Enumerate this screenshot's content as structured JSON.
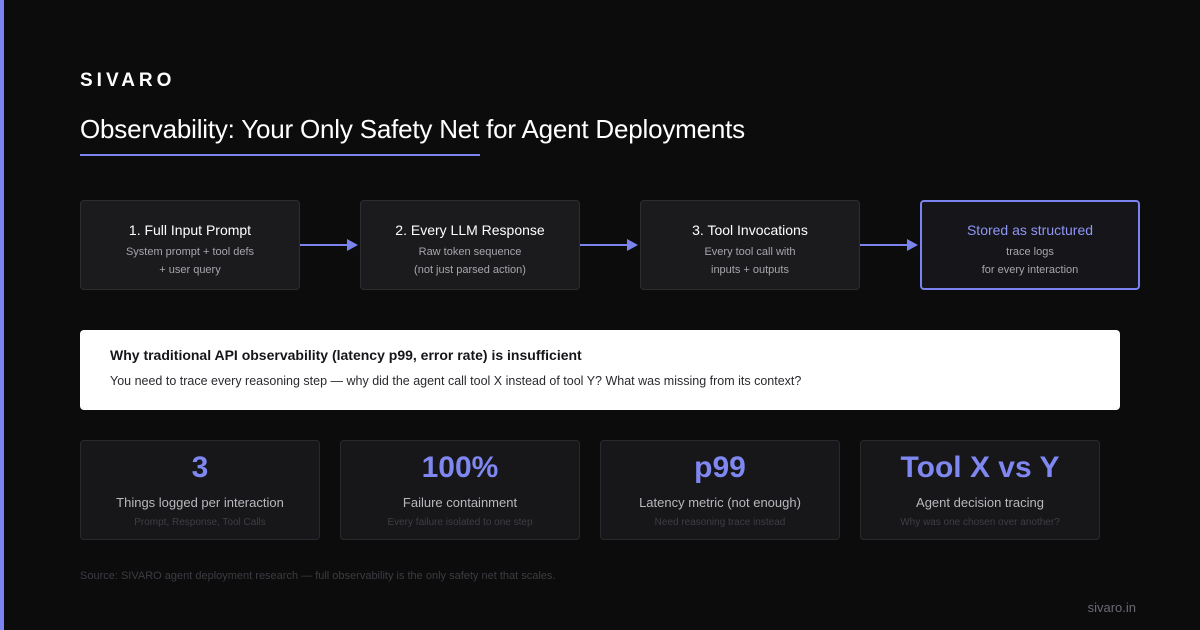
{
  "brand": "SIVARO",
  "title": "Observability: Your Only Safety Net for Agent Deployments",
  "colors": {
    "accent": "#7b83ee",
    "background": "#0c0c0d",
    "card": "#1b1b1e"
  },
  "flow": {
    "steps": [
      {
        "title": "1. Full Input Prompt",
        "line1": "System prompt + tool defs",
        "line2": "+ user query"
      },
      {
        "title": "2. Every LLM Response",
        "line1": "Raw token sequence",
        "line2": "(not just parsed action)"
      },
      {
        "title": "3. Tool Invocations",
        "line1": "Every tool call with",
        "line2": "inputs + outputs"
      },
      {
        "title": "Stored as structured",
        "line1": "trace logs",
        "line2": "for every interaction"
      }
    ],
    "arrow_icon": "arrow-right-icon"
  },
  "callout": {
    "heading": "Why traditional API observability (latency p99, error rate) is insufficient",
    "body": "You need to trace every reasoning step — why did the agent call tool X instead of tool Y? What was missing from its context?"
  },
  "stats": [
    {
      "value": "3",
      "label": "Things logged per interaction",
      "sub": "Prompt, Response, Tool Calls"
    },
    {
      "value": "100%",
      "label": "Failure containment",
      "sub": "Every failure isolated to one step"
    },
    {
      "value": "p99",
      "label": "Latency metric (not enough)",
      "sub": "Need reasoning trace instead"
    },
    {
      "value": "Tool X vs Y",
      "label": "Agent decision tracing",
      "sub": "Why was one chosen over another?"
    }
  ],
  "source": "Source: SIVARO agent deployment research — full observability is the only safety net that scales.",
  "footer_url": "sivaro.in"
}
